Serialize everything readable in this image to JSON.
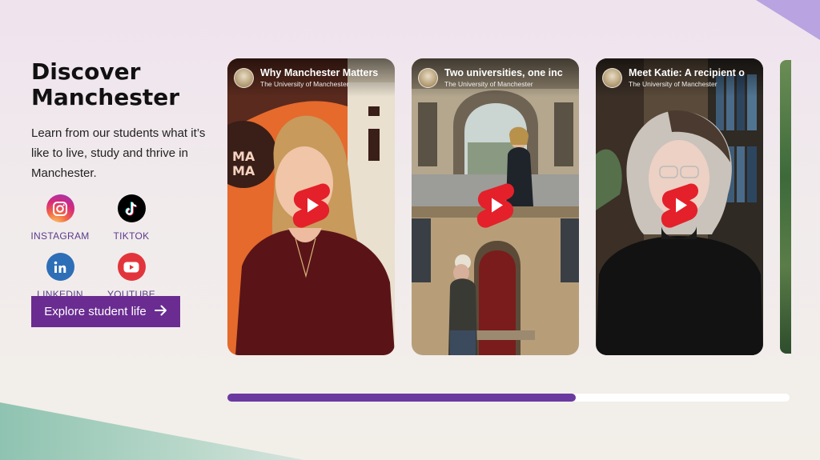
{
  "intro": {
    "headline_line1": "Discover",
    "headline_line2": "Manchester",
    "lede": "Learn from our students what it’s like to live, study and thrive in Manchester."
  },
  "socials": [
    {
      "label": "INSTAGRAM",
      "icon": "instagram-icon"
    },
    {
      "label": "TIKTOK",
      "icon": "tiktok-icon"
    },
    {
      "label": "LINKEDIN",
      "icon": "linkedin-icon"
    },
    {
      "label": "YOUTUBE",
      "icon": "youtube-icon"
    }
  ],
  "cta": {
    "label": "Explore student life",
    "icon": "arrow-right-icon"
  },
  "videos": [
    {
      "title": "Why Manchester Matters",
      "channel": "The University of Manchester",
      "icon": "youtube-shorts-icon"
    },
    {
      "title": "Two universities, one inc",
      "channel": "The University of Manchester",
      "icon": "youtube-shorts-icon"
    },
    {
      "title": "Meet Katie: A recipient o",
      "channel": "The University of Manchester",
      "icon": "youtube-shorts-icon"
    }
  ],
  "carousel": {
    "progress": 0.62
  },
  "colors": {
    "accent": "#6a2c91",
    "shorts_red": "#e4202b",
    "progress": "#6a3aa0"
  }
}
